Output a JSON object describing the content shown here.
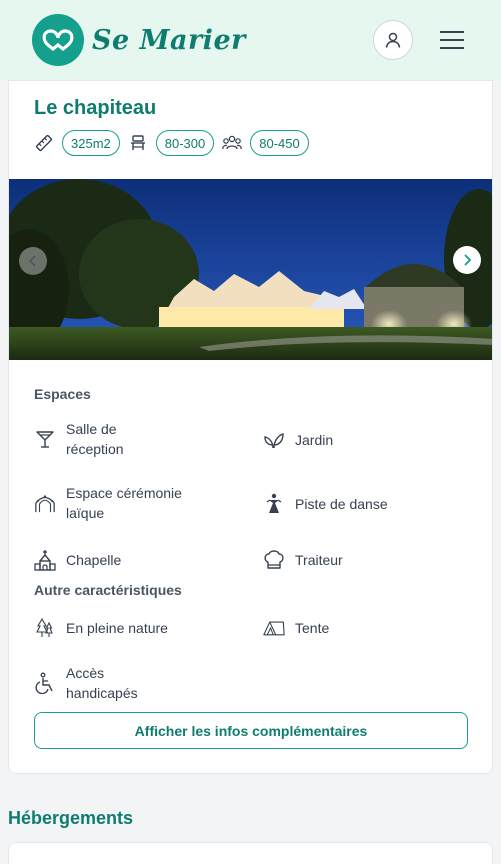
{
  "header": {
    "brand": "Se Marier",
    "account_icon": "user-icon",
    "menu_icon": "hamburger-icon"
  },
  "venue": {
    "title": "Le chapiteau",
    "badges": [
      {
        "icon": "ruler-icon",
        "value": "325m2"
      },
      {
        "icon": "seat-icon",
        "value": "80-300"
      },
      {
        "icon": "guests-icon",
        "value": "80-450"
      }
    ]
  },
  "gallery": {
    "prev_icon": "chevron-left-icon",
    "next_icon": "chevron-right-icon"
  },
  "spaces": {
    "label": "Espaces",
    "items": [
      {
        "icon": "cocktail-icon",
        "label": "Salle de réception"
      },
      {
        "icon": "leaf-icon",
        "label": "Jardin"
      },
      {
        "icon": "arch-icon",
        "label": "Espace cérémonie laïque"
      },
      {
        "icon": "dancer-icon",
        "label": "Piste de danse"
      },
      {
        "icon": "chapel-icon",
        "label": "Chapelle"
      },
      {
        "icon": "chef-hat-icon",
        "label": "Traiteur"
      }
    ]
  },
  "other": {
    "label": "Autre caractéristiques",
    "items": [
      {
        "icon": "trees-icon",
        "label": "En pleine nature"
      },
      {
        "icon": "tent-icon",
        "label": "Tente"
      },
      {
        "icon": "wheelchair-icon",
        "label": "Accès handicapés"
      }
    ]
  },
  "more_button": "Afficher les infos complémentaires",
  "accommodation": {
    "title": "Hébergements"
  },
  "colors": {
    "brand": "#14a08c",
    "brand_dark": "#0e7d70",
    "header_bg": "#e6f7f0"
  }
}
